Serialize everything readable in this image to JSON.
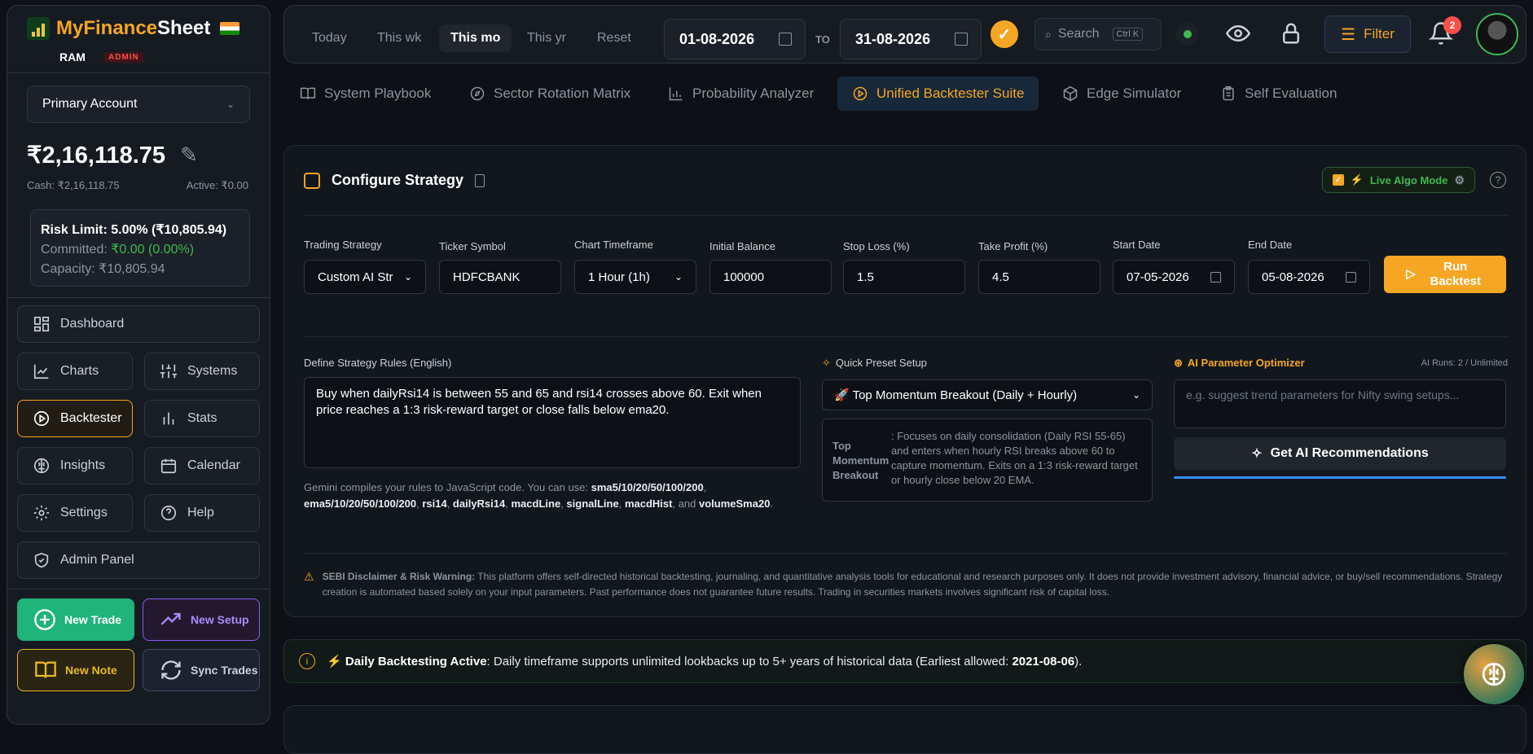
{
  "brand": {
    "name_a": "MyFinance",
    "name_b": "Sheet",
    "user": "RAM",
    "role": "ADMIN"
  },
  "account": {
    "selected": "Primary Account",
    "balance": "₹2,16,118.75",
    "cash": "Cash: ₹2,16,118.75",
    "active": "Active: ₹0.00"
  },
  "risk": {
    "limit": "Risk Limit: 5.00% (₹10,805.94)",
    "committed_label": "Committed: ",
    "committed_value": "₹0.00 (0.00%)",
    "capacity": "Capacity: ₹10,805.94"
  },
  "nav": {
    "dashboard": "Dashboard",
    "charts": "Charts",
    "systems": "Systems",
    "backtester": "Backtester",
    "stats": "Stats",
    "insights": "Insights",
    "calendar": "Calendar",
    "settings": "Settings",
    "help": "Help",
    "admin": "Admin Panel"
  },
  "actions": {
    "new_trade": "New Trade",
    "new_setup": "New Setup",
    "new_note": "New Note",
    "sync": "Sync Trades"
  },
  "header": {
    "today": "Today",
    "week": "This wk",
    "month": "This mo",
    "year": "This yr",
    "reset": "Reset",
    "from": "01-08-2026",
    "to_label": "TO",
    "to": "31-08-2026",
    "search": "Search",
    "search_kbd": "Ctrl K",
    "filter": "Filter",
    "notif_count": "2"
  },
  "tabs": {
    "playbook": "System Playbook",
    "sector": "Sector Rotation Matrix",
    "prob": "Probability Analyzer",
    "backtest": "Unified Backtester Suite",
    "edge": "Edge Simulator",
    "self": "Self Evaluation"
  },
  "strategy": {
    "title": "Configure Strategy",
    "live": "Live Algo Mode",
    "labels": {
      "strategy": "Trading Strategy",
      "ticker": "Ticker Symbol",
      "tf": "Chart Timeframe",
      "balance": "Initial Balance",
      "sl": "Stop Loss (%)",
      "tp": "Take Profit (%)",
      "start": "Start Date",
      "end": "End Date"
    },
    "values": {
      "strategy": "Custom AI Str",
      "ticker": "HDFCBANK",
      "tf": "1 Hour (1h)",
      "balance": "100000",
      "sl": "1.5",
      "tp": "4.5",
      "start": "07-05-2026",
      "end": "05-08-2026"
    },
    "run": "Run Backtest",
    "rules_label": "Define Strategy Rules (English)",
    "rules": "Buy when dailyRsi14 is between 55 and 65 and rsi14 crosses above 60. Exit when price reaches a 1:3 risk-reward target or close falls below ema20.",
    "hint_a": "Gemini compiles your rules to JavaScript code. You can use: ",
    "hint_b": "sma5/10/20/50/100/200",
    "hint_c": ", ",
    "hint_d": "ema5/10/20/50/100/200",
    "hint_e": "rsi14",
    "hint_f": "dailyRsi14",
    "hint_g": "macdLine",
    "hint_h": "signalLine",
    "hint_i": "macdHist",
    "hint_j": ", and ",
    "hint_k": "volumeSma20",
    "preset_label": "Quick Preset Setup",
    "preset": "🚀 Top Momentum Breakout (Daily + Hourly)",
    "preset_name": "Top Momentum Breakout",
    "preset_desc": ": Focuses on daily consolidation (Daily RSI 55-65) and enters when hourly RSI breaks above 60 to capture momentum. Exits on a 1:3 risk-reward target or hourly close below 20 EMA.",
    "ai_label": "AI Parameter Optimizer",
    "ai_runs": "AI Runs: 2 / Unlimited",
    "ai_placeholder": "e.g. suggest trend parameters for Nifty swing setups...",
    "ai_btn": "Get AI Recommendations",
    "disc_title": "SEBI Disclaimer & Risk Warning:",
    "disc_text": " This platform offers self-directed historical backtesting, journaling, and quantitative analysis tools for educational and research purposes only. It does not provide investment advisory, financial advice, or buy/sell recommendations. Strategy creation is automated based solely on your input parameters. Past performance does not guarantee future results. Trading in securities markets involves significant risk of capital loss."
  },
  "banner": {
    "title": "Daily Backtesting Active",
    "text": ": Daily timeframe supports unlimited lookbacks up to 5+ years of historical data (Earliest allowed: ",
    "date": "2021-08-06",
    "end": ")."
  }
}
